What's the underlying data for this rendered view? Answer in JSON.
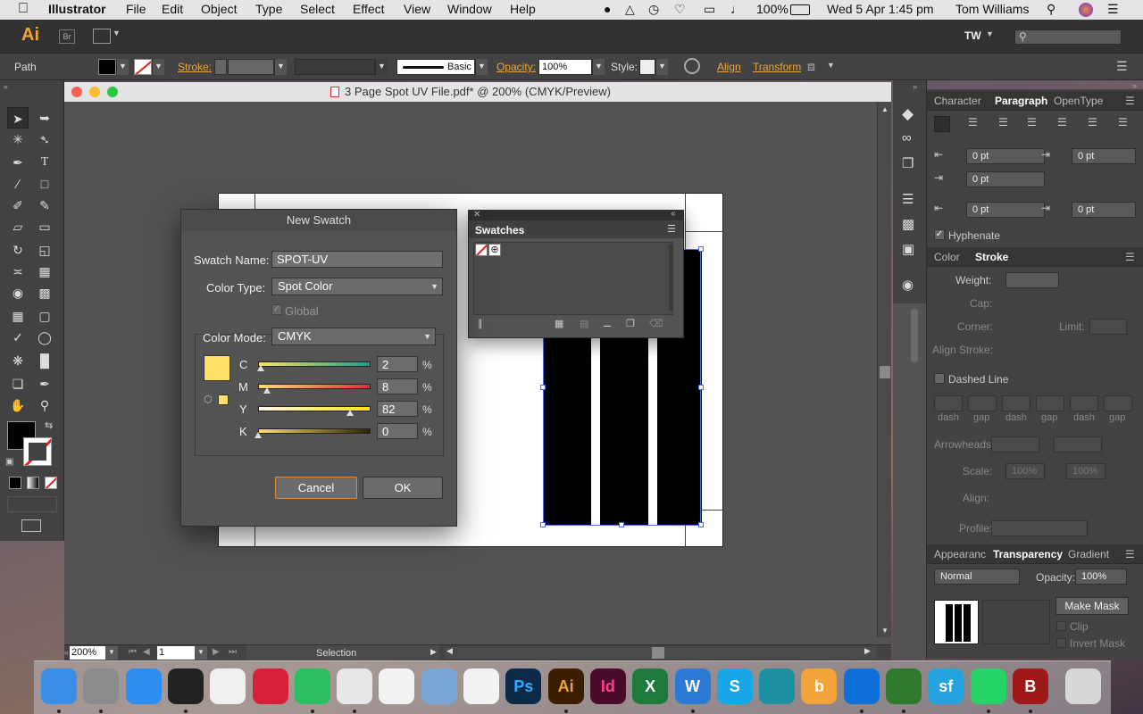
{
  "menubar": {
    "app": "Illustrator",
    "items": [
      "File",
      "Edit",
      "Object",
      "Type",
      "Select",
      "Effect",
      "View",
      "Window",
      "Help"
    ],
    "battery": "100%",
    "datetime": "Wed 5 Apr  1:45 pm",
    "user": "Tom Williams"
  },
  "appbar": {
    "logo": "Ai",
    "bridge": "Br",
    "workspace_initials": "TW"
  },
  "control": {
    "selection": "Path",
    "stroke_label": "Stroke:",
    "brush": "Basic",
    "opacity_label": "Opacity:",
    "opacity_value": "100%",
    "style_label": "Style:",
    "align_link": "Align",
    "transform_link": "Transform"
  },
  "document": {
    "title": "3 Page Spot UV File.pdf* @ 200% (CMYK/Preview)",
    "zoom": "200%",
    "page": "1",
    "status": "Selection"
  },
  "dialog": {
    "title": "New Swatch",
    "name_label": "Swatch Name:",
    "name_value": "SPOT-UV",
    "type_label": "Color Type:",
    "type_value": "Spot Color",
    "global_label": "Global",
    "mode_label": "Color Mode:",
    "mode_value": "CMYK",
    "swatch_color": "#ffe066",
    "channels": [
      {
        "label": "C",
        "value": "2",
        "unit": "%",
        "level": 0.02
      },
      {
        "label": "M",
        "value": "8",
        "unit": "%",
        "level": 0.08
      },
      {
        "label": "Y",
        "value": "82",
        "unit": "%",
        "level": 0.82
      },
      {
        "label": "K",
        "value": "0",
        "unit": "%",
        "level": 0.0
      }
    ],
    "cancel": "Cancel",
    "ok": "OK"
  },
  "swatches_panel": {
    "title": "Swatches"
  },
  "paragraph_panel": {
    "tabs": [
      "Character",
      "Paragraph",
      "OpenType"
    ],
    "active_tab": "Paragraph",
    "fields": [
      "0 pt",
      "0 pt",
      "0 pt",
      "0 pt",
      "0 pt"
    ],
    "hyphenate": "Hyphenate"
  },
  "stroke_panel": {
    "tabs": [
      "Color",
      "Stroke"
    ],
    "weight": "Weight:",
    "cap": "Cap:",
    "corner": "Corner:",
    "limit": "Limit:",
    "align_stroke": "Align Stroke:",
    "dashed_line": "Dashed Line",
    "dash_labels": [
      "dash",
      "gap",
      "dash",
      "gap",
      "dash",
      "gap"
    ],
    "arrowheads": "Arrowheads:",
    "scale": "Scale:",
    "scale_values": [
      "100%",
      "100%"
    ],
    "align": "Align:",
    "profile": "Profile:"
  },
  "transparency_panel": {
    "tabs": [
      "Appearanc",
      "Transparency",
      "Gradient"
    ],
    "blend_mode": "Normal",
    "opacity_label": "Opacity:",
    "opacity_value": "100%",
    "make_mask": "Make Mask",
    "clip": "Clip",
    "invert_mask": "Invert Mask"
  },
  "dock": {
    "apps": [
      {
        "name": "finder-icon",
        "label": "",
        "color": "#3a8ee6"
      },
      {
        "name": "system-preferences-icon",
        "label": "",
        "color": "#8c8c8c"
      },
      {
        "name": "app-store-icon",
        "label": "",
        "color": "#2c8ef0"
      },
      {
        "name": "dashboard-icon",
        "label": "",
        "color": "#222222"
      },
      {
        "name": "itunes-icon",
        "label": "",
        "color": "#f0f0f0"
      },
      {
        "name": "lips-app-icon",
        "label": "",
        "color": "#d8203a"
      },
      {
        "name": "evernote-icon",
        "label": "",
        "color": "#2dbe60"
      },
      {
        "name": "chrome-icon",
        "label": "",
        "color": "#e8e8e8"
      },
      {
        "name": "textedit-icon",
        "label": "",
        "color": "#f2f2f2"
      },
      {
        "name": "preview-icon",
        "label": "",
        "color": "#7aa6d6"
      },
      {
        "name": "acrobat-icon",
        "label": "",
        "color": "#f3f3f3"
      },
      {
        "name": "photoshop-icon",
        "label": "Ps",
        "color": "#0b2a4a"
      },
      {
        "name": "illustrator-icon",
        "label": "Ai",
        "color": "#3b1d00"
      },
      {
        "name": "indesign-icon",
        "label": "Id",
        "color": "#4a0b2a"
      },
      {
        "name": "excel-icon",
        "label": "X",
        "color": "#1d7a3a"
      },
      {
        "name": "word-icon",
        "label": "W",
        "color": "#2b7bd6"
      },
      {
        "name": "skype-icon",
        "label": "S",
        "color": "#17a7e6"
      },
      {
        "name": "security-icon",
        "label": "",
        "color": "#1c8fa0"
      },
      {
        "name": "bookmark-app-icon",
        "label": "b",
        "color": "#f2a33a"
      },
      {
        "name": "teamviewer-icon",
        "label": "",
        "color": "#0e6fd8"
      },
      {
        "name": "camtasia-icon",
        "label": "",
        "color": "#2d7a2d"
      },
      {
        "name": "salesforce-icon",
        "label": "sf",
        "color": "#24a3e0"
      },
      {
        "name": "whatsapp-icon",
        "label": "",
        "color": "#25d366"
      },
      {
        "name": "bbedit-icon",
        "label": "B",
        "color": "#a01818"
      },
      {
        "name": "trash-icon",
        "label": "",
        "color": "#d8d8d8"
      }
    ]
  }
}
